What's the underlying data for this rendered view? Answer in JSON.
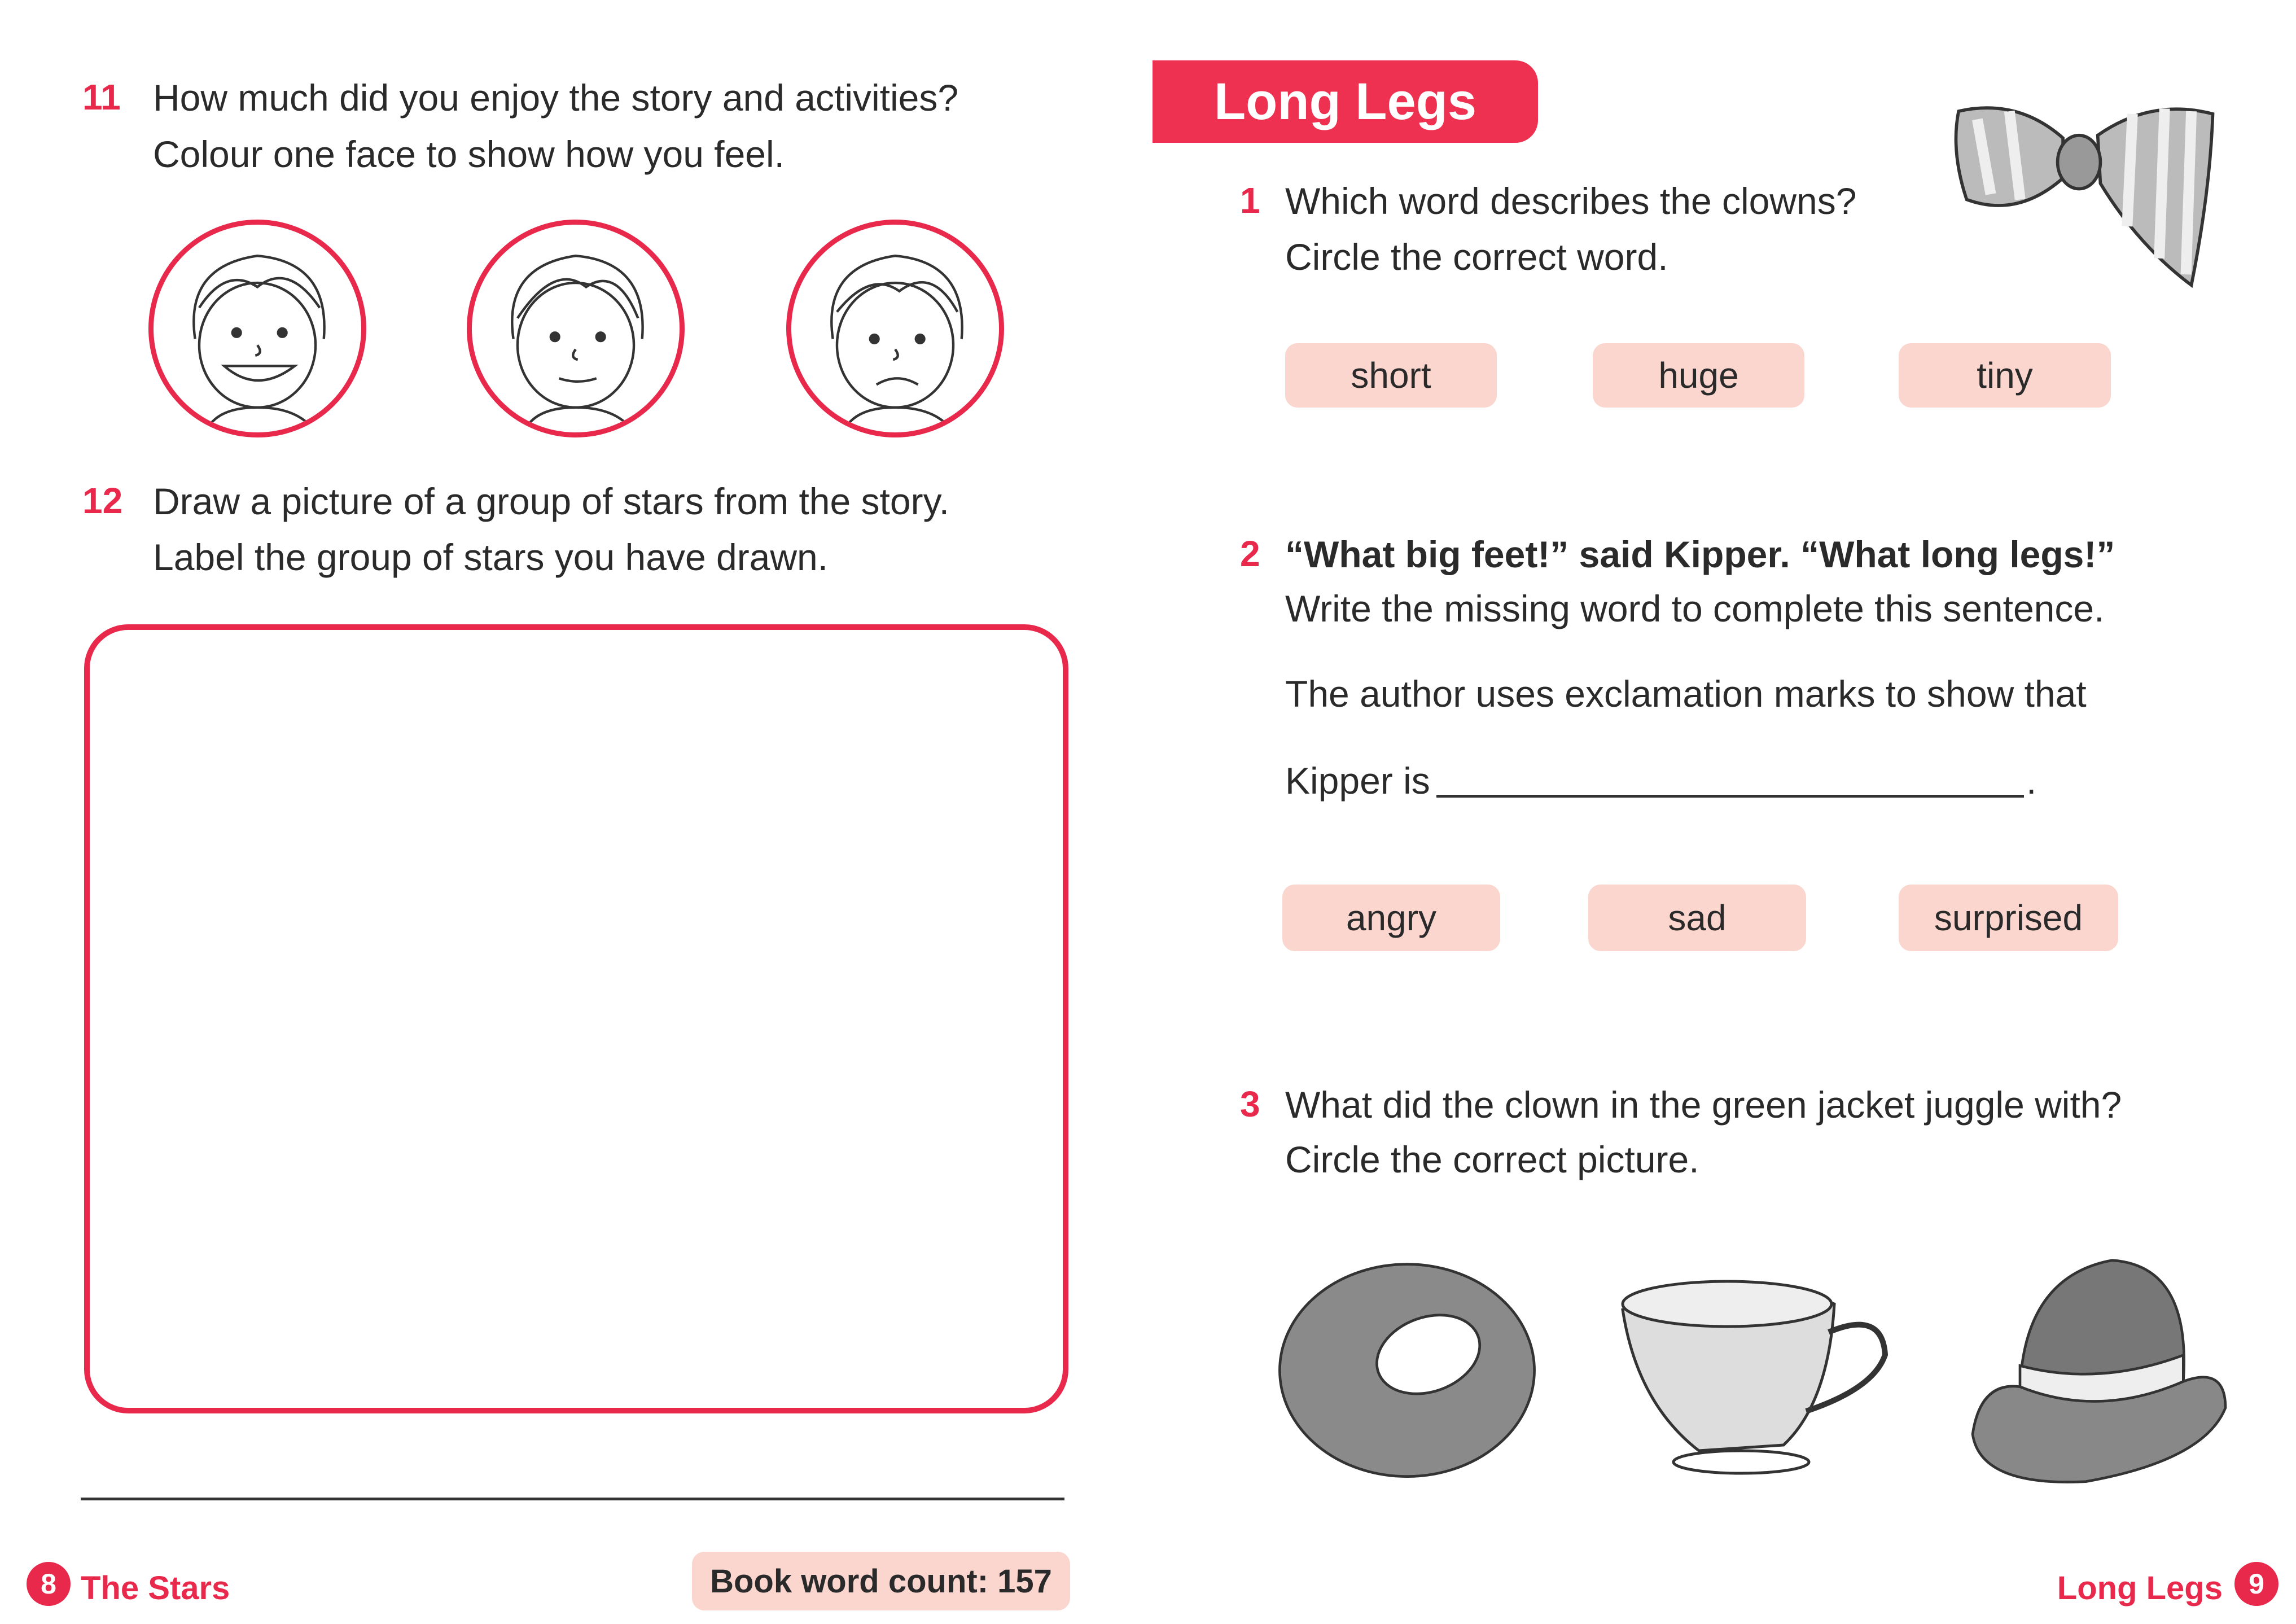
{
  "left_page": {
    "q11": {
      "number": "11",
      "line1": "How much did you enjoy the story and activities?",
      "line2": "Colour one face to show how you feel.",
      "faces": [
        "happy-face",
        "neutral-face",
        "sad-face"
      ]
    },
    "q12": {
      "number": "12",
      "line1": "Draw a picture of a group of stars from the story.",
      "line2": "Label the group of stars you have drawn."
    },
    "footer": {
      "page_number": "8",
      "title": "The Stars",
      "word_count": "Book word count: 157"
    }
  },
  "right_page": {
    "title": "Long Legs",
    "q1": {
      "number": "1",
      "line1": "Which word describes the clowns?",
      "line2": "Circle the correct word.",
      "options": [
        "short",
        "huge",
        "tiny"
      ]
    },
    "q2": {
      "number": "2",
      "line1": "“What big feet!” said Kipper. “What long legs!”",
      "line2": "Write the missing word to complete this sentence.",
      "line3": "The author uses exclamation marks to show that",
      "line4": "Kipper is",
      "end": ".",
      "options": [
        "angry",
        "sad",
        "surprised"
      ]
    },
    "q3": {
      "number": "3",
      "line1": "What did the clown in the green jacket juggle with?",
      "line2": "Circle the correct picture.",
      "pictures": [
        "ring",
        "cup",
        "hat"
      ]
    },
    "footer": {
      "page_number": "9",
      "title": "Long Legs"
    }
  },
  "colors": {
    "accent": "#e8294c",
    "chip": "#fad6cf"
  }
}
